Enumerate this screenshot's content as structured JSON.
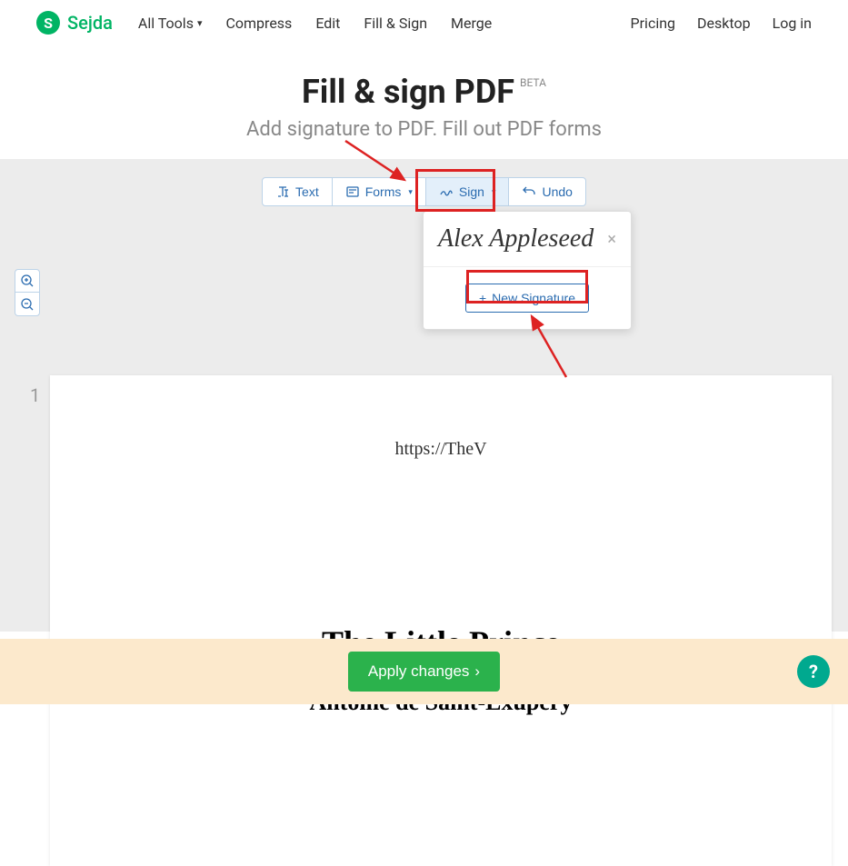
{
  "header": {
    "logo_letter": "S",
    "logo_text": "Sejda",
    "nav": {
      "all_tools": "All Tools",
      "compress": "Compress",
      "edit": "Edit",
      "fill_sign": "Fill & Sign",
      "merge": "Merge"
    },
    "right": {
      "pricing": "Pricing",
      "desktop": "Desktop",
      "login": "Log in"
    }
  },
  "hero": {
    "title": "Fill & sign PDF",
    "beta": "BETA",
    "subtitle": "Add signature to PDF. Fill out PDF forms"
  },
  "toolbar": {
    "text": "Text",
    "forms": "Forms",
    "sign": "Sign",
    "undo": "Undo"
  },
  "page": {
    "number": "1",
    "url_text": "https://TheV",
    "book_title": "The Little Prince",
    "book_author": "Antoine de Saint-Exupéry"
  },
  "sign_popup": {
    "signature_name": "Alex Appleseed",
    "new_signature": "New Signature"
  },
  "footer": {
    "apply": "Apply changes"
  },
  "help": "?"
}
